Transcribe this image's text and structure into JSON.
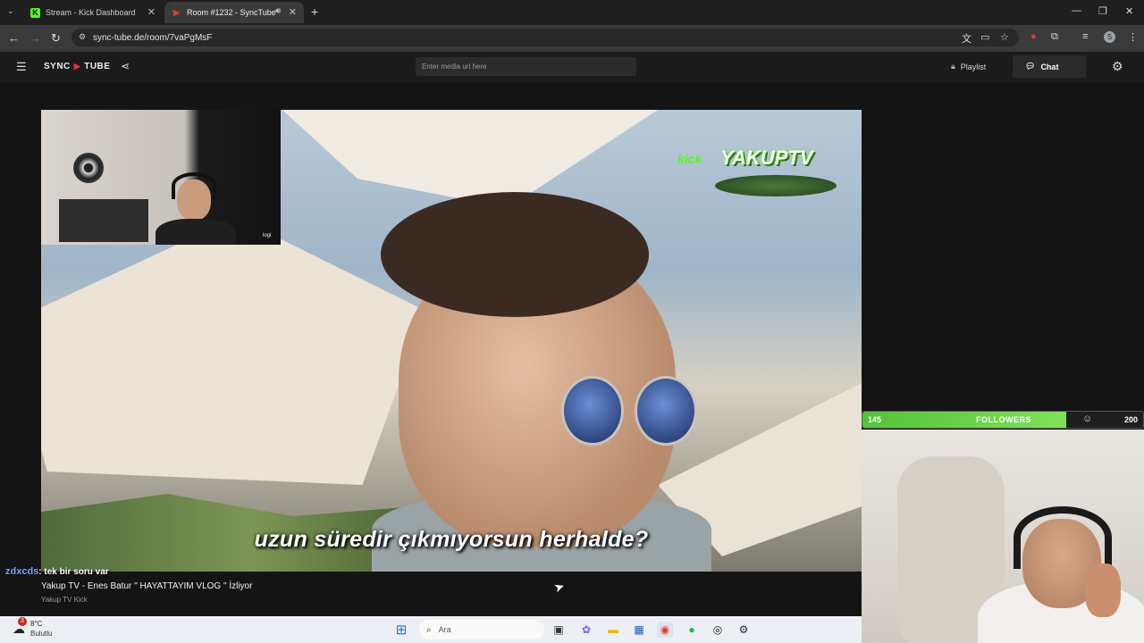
{
  "browser": {
    "tabs": [
      {
        "title": "Stream - Kick Dashboard",
        "favicon": "kick-icon",
        "active": false
      },
      {
        "title": "Room #1232 - SyncTube",
        "favicon": "synctube-icon",
        "active": true
      }
    ],
    "url": "sync-tube.de/room/7vaPgMsF",
    "new_tab": "+",
    "profile_initial": "S"
  },
  "app": {
    "logo_left": "SYNC",
    "logo_right": "TUBE",
    "media_placeholder": "Enter media url here",
    "playlist_label": "Playlist",
    "chat_label": "Chat"
  },
  "video": {
    "subtitle": "uzun süredir çıkmıyorsun herhalde?",
    "watermark_small": "kick",
    "watermark_brand": "YAKUPTV",
    "webcam_label": "logi"
  },
  "chat_overlay": {
    "username": "zdxcds",
    "message": ": tek bir soru var"
  },
  "now_playing": {
    "title": "Yakup TV - Enes Batur \" HAYATTAYIM VLOG \" İzliyor",
    "channel": "Yakup TV Kick"
  },
  "followers_goal": {
    "current": "145",
    "label": "FOLLOWERS",
    "goal": "200",
    "progress": 0.725
  },
  "taskbar": {
    "weather_temp": "8°C",
    "weather_cond": "Bulutlu",
    "weather_badge": "3",
    "search_label": "Ara"
  },
  "colors": {
    "accent_green": "#53fc18",
    "youtube_red": "#e53935"
  }
}
